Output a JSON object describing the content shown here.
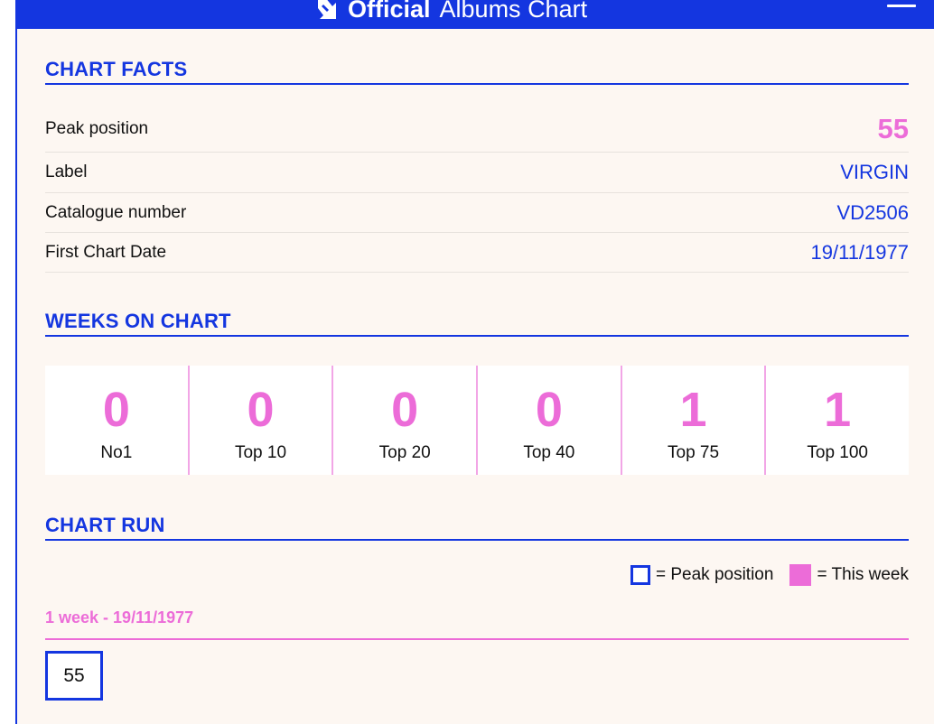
{
  "header": {
    "brand_strong": "Official",
    "brand_light": "Albums Chart",
    "logo_icon": "official-charts-logo-icon",
    "menu_icon": "hamburger-menu-icon"
  },
  "chart_facts": {
    "title": "CHART FACTS",
    "rows": [
      {
        "label": "Peak position",
        "value": "55"
      },
      {
        "label": "Label",
        "value": "VIRGIN"
      },
      {
        "label": "Catalogue number",
        "value": "VD2506"
      },
      {
        "label": "First Chart Date",
        "value": "19/11/1977"
      }
    ]
  },
  "weeks_on_chart": {
    "title": "WEEKS ON CHART",
    "cells": [
      {
        "count": "0",
        "label": "No1"
      },
      {
        "count": "0",
        "label": "Top 10"
      },
      {
        "count": "0",
        "label": "Top 20"
      },
      {
        "count": "0",
        "label": "Top 40"
      },
      {
        "count": "1",
        "label": "Top 75"
      },
      {
        "count": "1",
        "label": "Top 100"
      }
    ]
  },
  "chart_run": {
    "title": "CHART RUN",
    "legend_peak": "= Peak position",
    "legend_this_week": "= This week",
    "period": "1 week - 19/11/1977",
    "positions": [
      "55"
    ]
  },
  "colors": {
    "brand_blue": "#1436e0",
    "accent_pink": "#ec6cd8",
    "page_bg": "#fdf7f2"
  }
}
